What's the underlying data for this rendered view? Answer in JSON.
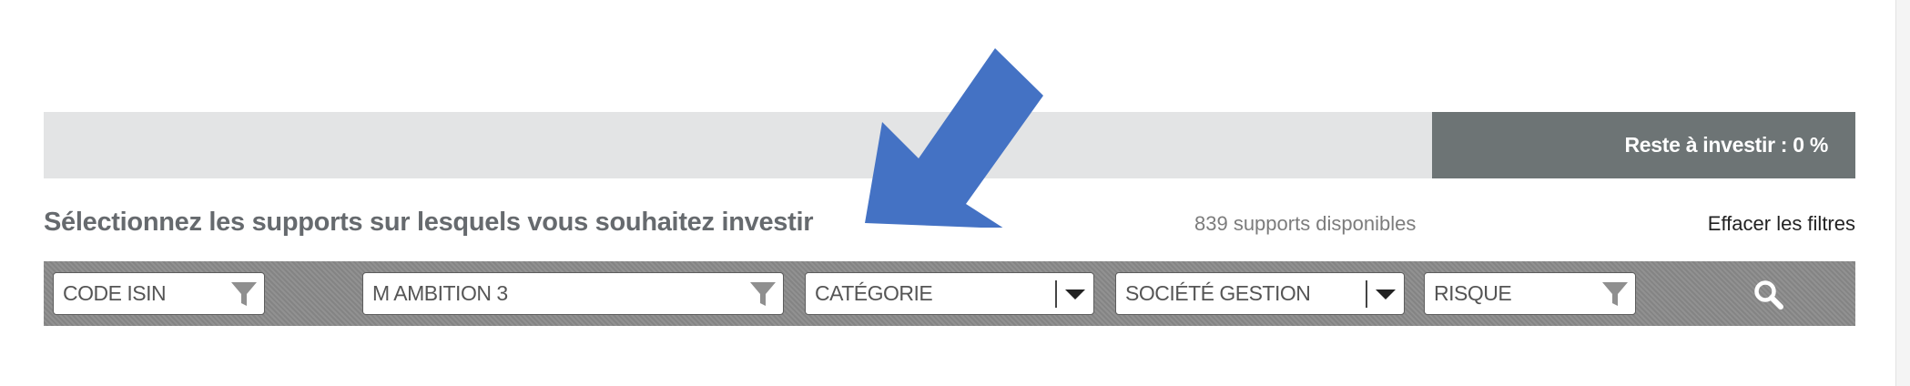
{
  "progress": {
    "remaining_label": "Reste à investir : 0 %",
    "remaining_percent": 0
  },
  "heading": {
    "instruction": "Sélectionnez les supports sur lesquels vous souhaitez investir",
    "count": "839 supports disponibles",
    "clear_filters": "Effacer les filtres"
  },
  "filters": {
    "isin": {
      "placeholder": "CODE ISIN"
    },
    "name": {
      "value": "M AMBITION 3"
    },
    "category": {
      "placeholder": "CATÉGORIE"
    },
    "company": {
      "placeholder": "SOCIÉTÉ GESTION"
    },
    "risk": {
      "placeholder": "RISQUE"
    }
  },
  "icons": {
    "filter": "funnel-icon",
    "dropdown": "caret-down-icon",
    "search": "search-icon",
    "annotation": "arrow-icon"
  },
  "colors": {
    "arrow": "#4472c4",
    "remaining_bg": "#6d7475",
    "track_bg": "#e3e4e5",
    "filter_bar_bg": "#8b8b8b"
  }
}
